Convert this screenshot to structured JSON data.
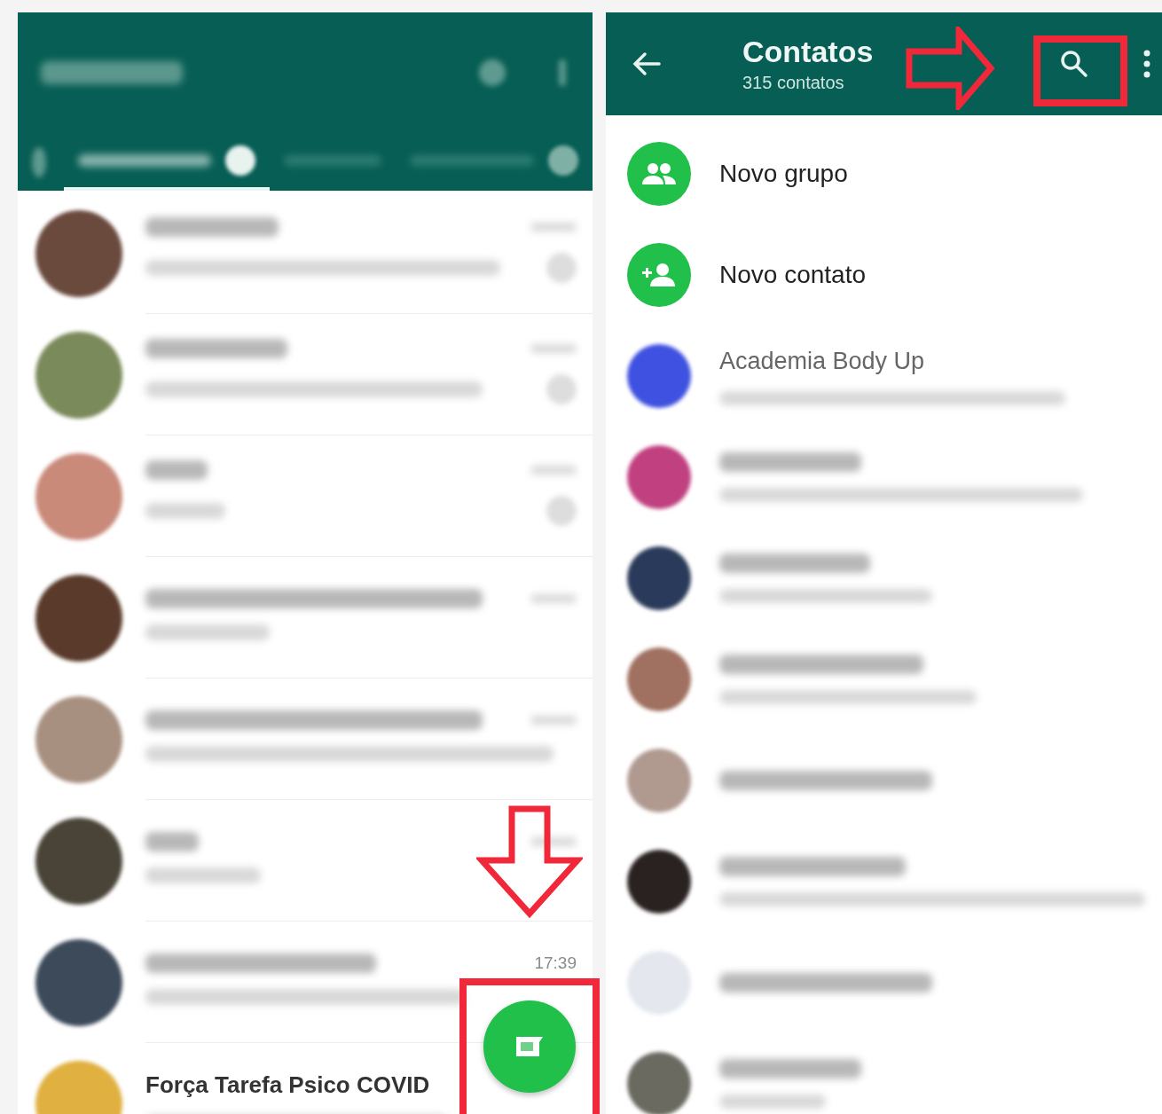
{
  "chats_screen": {
    "tabs": [
      {
        "selected": true
      },
      {
        "selected": false
      },
      {
        "selected": false
      }
    ],
    "chats": [
      {
        "kind": "blurred"
      },
      {
        "kind": "blurred"
      },
      {
        "kind": "blurred"
      },
      {
        "kind": "blurred"
      },
      {
        "kind": "blurred"
      },
      {
        "kind": "blurred"
      },
      {
        "kind": "blurred",
        "time": "17:39"
      },
      {
        "kind": "named",
        "name": "Força Tarefa Psico COVID"
      }
    ]
  },
  "contacts_screen": {
    "header": {
      "title": "Contatos",
      "subtitle": "315 contatos"
    },
    "actions": [
      {
        "kind": "new-group",
        "label": "Novo grupo"
      },
      {
        "kind": "new-contact",
        "label": "Novo contato"
      }
    ],
    "contacts": [
      {
        "kind": "named",
        "name": "Academia Body Up"
      },
      {
        "kind": "blurred"
      },
      {
        "kind": "blurred"
      },
      {
        "kind": "blurred"
      },
      {
        "kind": "blurred"
      },
      {
        "kind": "blurred"
      },
      {
        "kind": "blurred"
      },
      {
        "kind": "blurred"
      }
    ]
  }
}
